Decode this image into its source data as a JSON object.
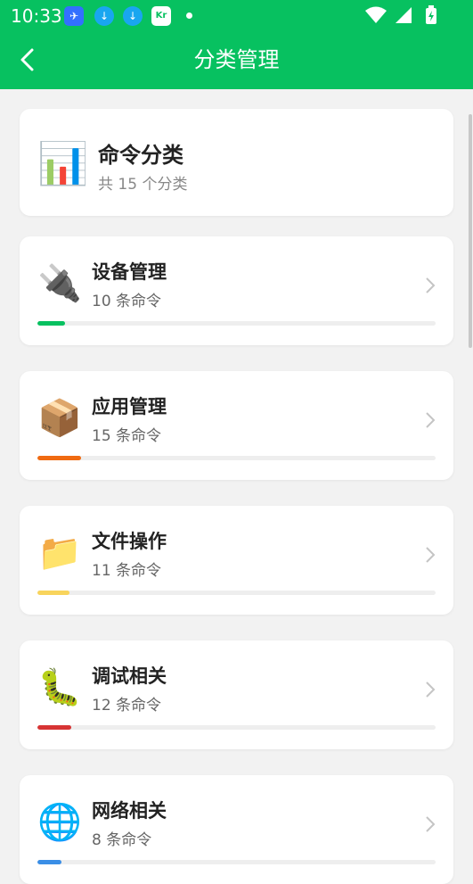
{
  "status_bar": {
    "time": "10:33",
    "notifications": [
      "feishu-icon",
      "download-icon",
      "download-icon",
      "36kr-icon"
    ]
  },
  "header": {
    "title": "分类管理",
    "background": "#07c160"
  },
  "summary": {
    "icon": "📊",
    "title": "命令分类",
    "subtitle": "共 15 个分类"
  },
  "categories": [
    {
      "icon": "🔌",
      "name": "设备管理",
      "count_text": "10 条命令",
      "count": 10,
      "color": "#07c160",
      "fill_fraction": 0.07
    },
    {
      "icon": "📦",
      "name": "应用管理",
      "count_text": "15 条命令",
      "count": 15,
      "color": "#f06a11",
      "fill_fraction": 0.11
    },
    {
      "icon": "📁",
      "name": "文件操作",
      "count_text": "11 条命令",
      "count": 11,
      "color": "#f8d45c",
      "fill_fraction": 0.08
    },
    {
      "icon": "🐛",
      "name": "调试相关",
      "count_text": "12 条命令",
      "count": 12,
      "color": "#d73434",
      "fill_fraction": 0.085
    },
    {
      "icon": "🌐",
      "name": "网络相关",
      "count_text": "8 条命令",
      "count": 8,
      "color": "#3a8ee6",
      "fill_fraction": 0.06
    }
  ]
}
